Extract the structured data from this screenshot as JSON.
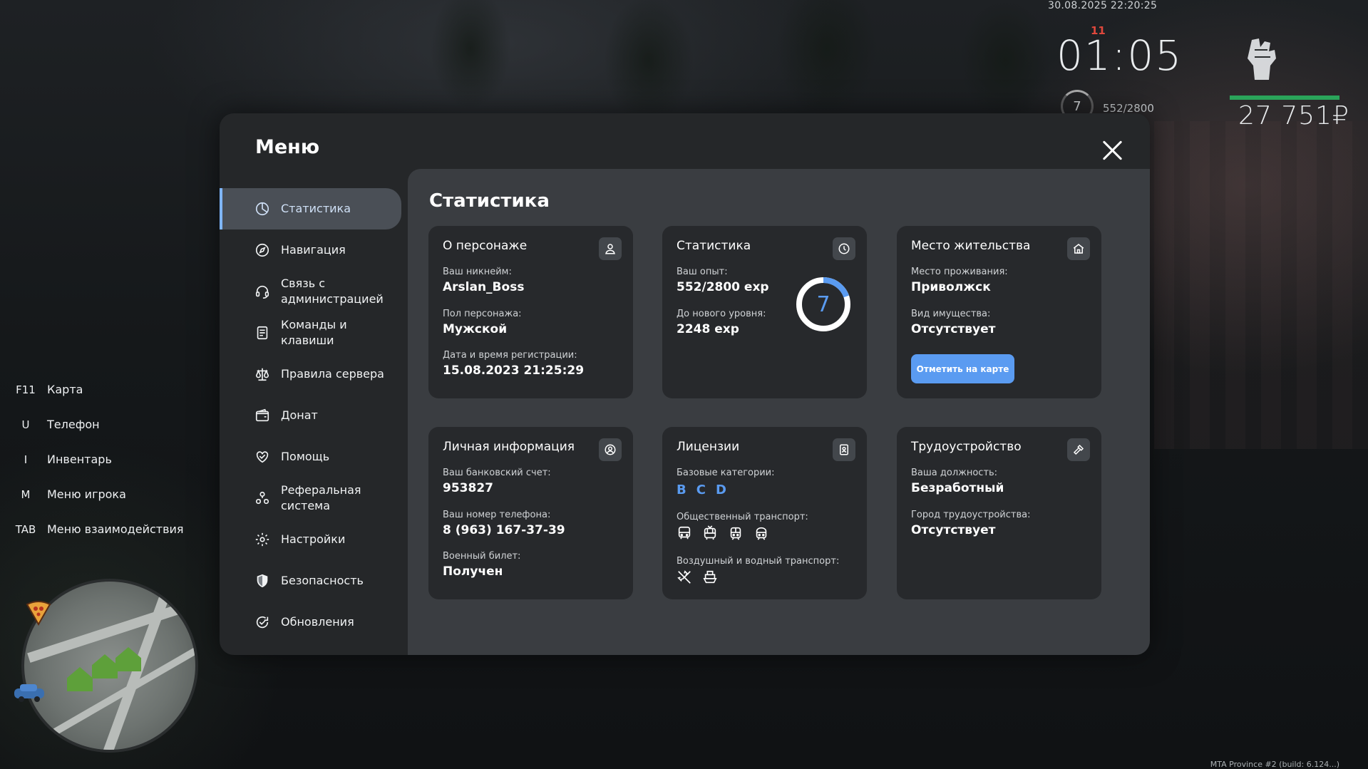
{
  "hud": {
    "datetime": "30.08.2025 22:20:25",
    "clock": "01:05",
    "clock_mark": "11",
    "level": "7",
    "exp": "552/2800",
    "money": "27 751₽",
    "health_color": "#2aa45a"
  },
  "hotkeys": [
    {
      "key": "F11",
      "label": "Карта"
    },
    {
      "key": "U",
      "label": "Телефон"
    },
    {
      "key": "I",
      "label": "Инвентарь"
    },
    {
      "key": "M",
      "label": "Меню игрока"
    },
    {
      "key": "TAB",
      "label": "Меню взаимодействия"
    }
  ],
  "build": "MTA Province #2 (build: 6.124...)",
  "menu": {
    "title": "Меню",
    "accent": "#5a9bf1",
    "items": [
      {
        "label": "Статистика",
        "icon": "pie-chart-icon",
        "active": true
      },
      {
        "label": "Навигация",
        "icon": "compass-icon"
      },
      {
        "label": "Связь с\nадминистрацией",
        "icon": "headset-icon"
      },
      {
        "label": "Команды и\nклавиши",
        "icon": "document-icon"
      },
      {
        "label": "Правила сервера",
        "icon": "scales-icon"
      },
      {
        "label": "Донат",
        "icon": "wallet-icon"
      },
      {
        "label": "Помощь",
        "icon": "heart-hand-icon"
      },
      {
        "label": "Реферальная\nсистема",
        "icon": "people-icon"
      },
      {
        "label": "Настройки",
        "icon": "gear-icon"
      },
      {
        "label": "Безопасность",
        "icon": "shield-icon"
      },
      {
        "label": "Обновления",
        "icon": "refresh-check-icon"
      }
    ]
  },
  "stats": {
    "title": "Статистика",
    "character": {
      "title": "О персонаже",
      "nick_label": "Ваш никнейм:",
      "nick": "Arslan_Boss",
      "gender_label": "Пол персонажа:",
      "gender": "Мужской",
      "reg_label": "Дата и время регистрации:",
      "reg": "15.08.2023 21:25:29"
    },
    "statistics": {
      "title": "Статистика",
      "exp_label": "Ваш опыт:",
      "exp": "552/2800 exp",
      "next_label": "До нового уровня:",
      "next": "2248 exp",
      "level": "7",
      "progress": 0.197
    },
    "residence": {
      "title": "Место жительства",
      "place_label": "Место проживания:",
      "place": "Приволжск",
      "property_label": "Вид имущества:",
      "property": "Отсутствует",
      "button": "Отметить на карте"
    },
    "personal": {
      "title": "Личная информация",
      "bank_label": "Ваш банковский счет:",
      "bank": "953827",
      "phone_label": "Ваш номер телефона:",
      "phone": "8 (963) 167-37-39",
      "military_label": "Военный билет:",
      "military": "Получен"
    },
    "licenses": {
      "title": "Лицензии",
      "base_label": "Базовые категории:",
      "categories": [
        "B",
        "C",
        "D"
      ],
      "public_label": "Общественный транспорт:",
      "air_label": "Воздушный и водный транспорт:"
    },
    "employment": {
      "title": "Трудоустройство",
      "position_label": "Ваша должность:",
      "position": "Безработный",
      "city_label": "Город трудоустройства:",
      "city": "Отсутствует"
    }
  }
}
